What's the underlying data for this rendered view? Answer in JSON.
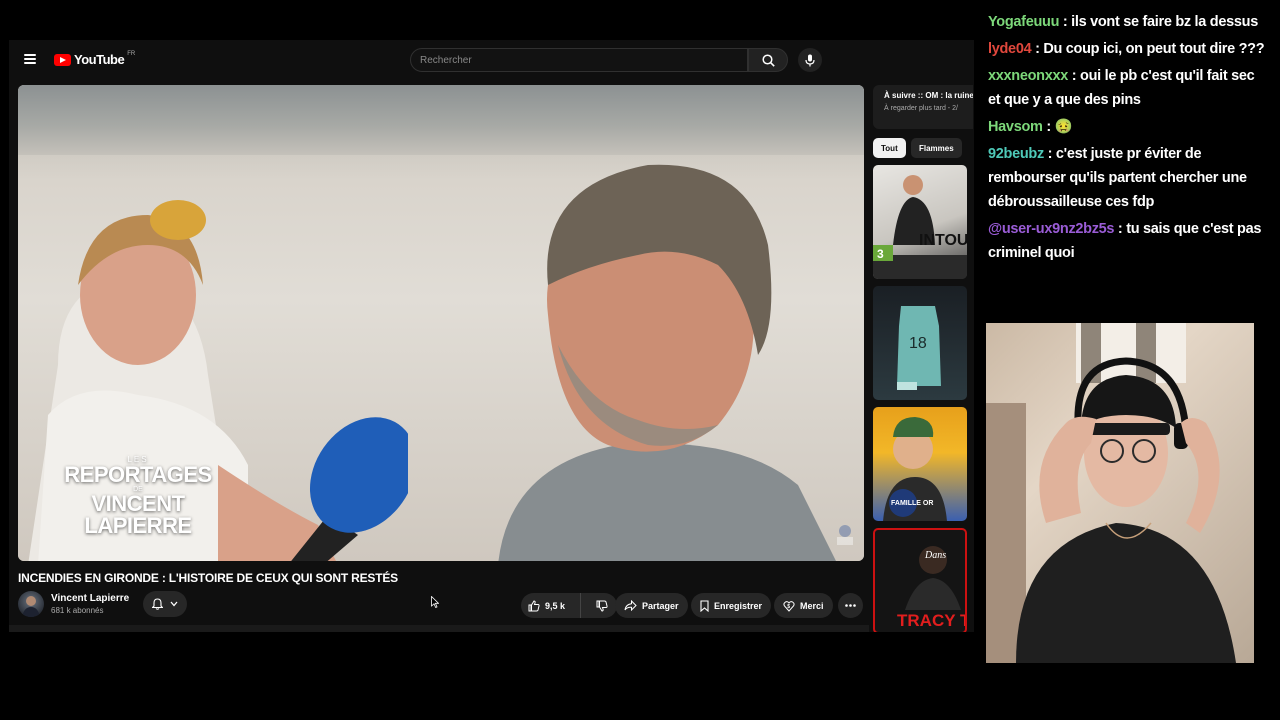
{
  "youtube": {
    "logo_text": "YouTube",
    "logo_country": "FR",
    "search_placeholder": "Rechercher",
    "video": {
      "overlay_small": "LES",
      "overlay_line1": "REPORTAGES",
      "overlay_mid": "DE",
      "overlay_line2": "VINCENT LAPIERRE",
      "title": "INCENDIES EN GIRONDE : L'HISTOIRE DE CEUX QUI SONT RESTÉS"
    },
    "channel": {
      "name": "Vincent Lapierre",
      "subscribers": "681 k abonnés"
    },
    "actions": {
      "likes": "9,5 k",
      "share": "Partager",
      "save": "Enregistrer",
      "thanks": "Merci"
    },
    "sidebar": {
      "next_up_title": "À suivre :: OM : la ruine",
      "next_up_sub": "À regarder plus tard - 2/",
      "chips": [
        "Tout",
        "Flammes"
      ],
      "thumbnails": [
        {
          "text": "INTOU",
          "badge": "3"
        },
        {
          "text": "18"
        },
        {
          "text": "FAMILLE OR"
        },
        {
          "text": "TRACY T",
          "script": "Dans"
        }
      ]
    }
  },
  "chat": {
    "messages": [
      {
        "user": "Yogafeuuu",
        "color": "#7dd87a",
        "text": " : ils vont se faire bz la dessus"
      },
      {
        "user": "lyde04",
        "color": "#e0473c",
        "text": " : Du coup ici, on peut tout dire ???"
      },
      {
        "user": "xxxneonxxx",
        "color": "#7dd87a",
        "text": " : oui le pb c'est qu'il fait sec et que y a que des pins"
      },
      {
        "user": "Havsom",
        "color": "#7dd87a",
        "text": " : ",
        "emoji": "🤢"
      },
      {
        "user": "92beubz",
        "color": "#4ec9b8",
        "text": " : c'est juste pr éviter de rembourser qu'ils partent chercher une débroussailleuse ces fdp"
      },
      {
        "user": "@user-ux9nz2bz5s",
        "color": "#9a5cd6",
        "text": " : tu sais que c'est pas criminel quoi"
      }
    ]
  }
}
